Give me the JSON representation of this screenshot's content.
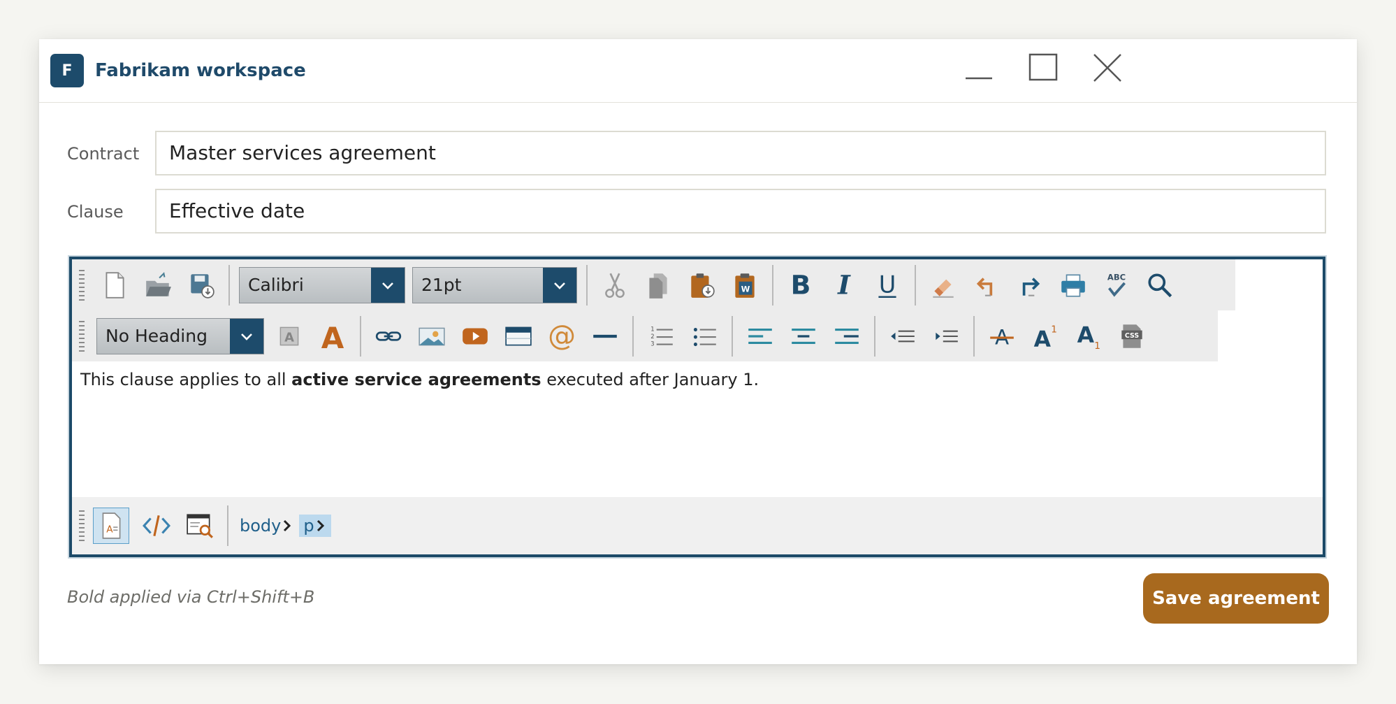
{
  "window": {
    "app_initial": "F",
    "title": "Fabrikam workspace"
  },
  "form": {
    "contract_label": "Contract",
    "contract_value": "Master services agreement",
    "clause_label": "Clause",
    "clause_value": "Effective date"
  },
  "toolbar": {
    "font_name": "Calibri",
    "font_size": "21pt",
    "heading": "No Heading",
    "css_label": "CSS",
    "spellcheck_label": "ABC",
    "superscript_mark": "1",
    "subscript_mark": "1"
  },
  "editor": {
    "text_before": "This clause applies to all ",
    "text_bold": "active service agreements",
    "text_after": " executed after January 1."
  },
  "statusbar": {
    "crumbs": [
      "body",
      "p"
    ]
  },
  "footer": {
    "note": "Bold applied via Ctrl+Shift+B",
    "save_label": "Save agreement"
  },
  "colors": {
    "navy": "#1d4b6b",
    "accent": "#a8691e",
    "orange": "#c0651e",
    "teal": "#2c8aa0"
  }
}
